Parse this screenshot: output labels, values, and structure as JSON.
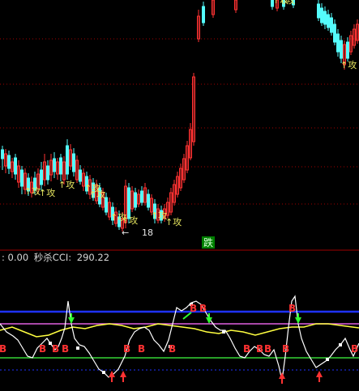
{
  "info_bar": {
    "prefix": ": 0.00",
    "indicator_name": "秒杀CCI:",
    "indicator_value": "290.22"
  },
  "price_panel": {
    "min_price_label": "18",
    "signal_label": "攻",
    "signal_prefix": "↑",
    "fall_label": "跌"
  },
  "indicator_panel": {
    "buy_label": "B"
  },
  "colors": {
    "up_candle": "#ff3232",
    "down_candle": "#54fcfc",
    "grid_dotted": "#a00000",
    "panel_separator": "#a00000",
    "band_blue": "#1e32ff",
    "band_magenta": "#e060e0",
    "yellow_line": "#ffff40",
    "green_line": "#40ff40",
    "white_line": "#ffffff",
    "fall_badge_bg": "#008000"
  }
}
